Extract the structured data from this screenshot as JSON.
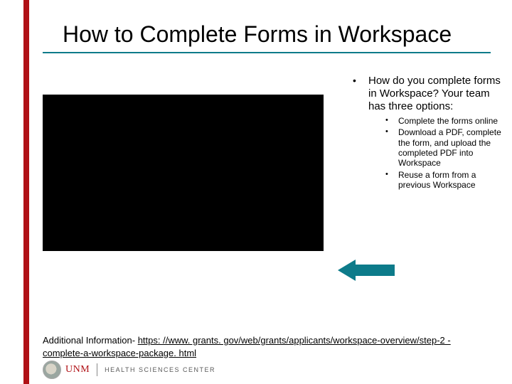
{
  "title": "How to Complete Forms in Workspace",
  "main_bullet": " How do you complete forms in Workspace? Your team has three options:",
  "sub_bullets": [
    "Complete the forms online",
    "Download a PDF, complete the form, and upload the completed PDF into Workspace",
    "Reuse a form from a previous Workspace"
  ],
  "addl_label": "Additional Information- ",
  "addl_url": "https: //www. grants. gov/web/grants/applicants/workspace-overview/step-2 -complete-a-workspace-package. html",
  "logo": {
    "unm": "UNM",
    "hsc": "HEALTH SCIENCES CENTER"
  }
}
